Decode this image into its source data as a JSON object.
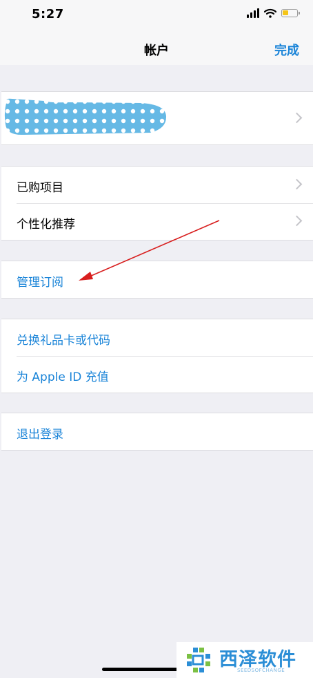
{
  "status_bar": {
    "time": "5:27"
  },
  "nav": {
    "title": "帐户",
    "done": "完成"
  },
  "sections": {
    "account": {
      "name_redacted": ""
    },
    "purchases": {
      "purchased": "已购项目",
      "personalized": "个性化推荐"
    },
    "subscriptions": {
      "manage": "管理订阅"
    },
    "redeem": {
      "redeem_gift": "兑换礼品卡或代码",
      "add_funds": "为 Apple ID 充值"
    },
    "signout": {
      "label": "退出登录"
    }
  },
  "watermark": {
    "title": "西泽软件",
    "subtitle": "SEEDSOFCHANGE"
  },
  "colors": {
    "accent": "#1a84d8",
    "arrow": "#d81e1e",
    "redaction": "#66b9e5",
    "battery": "#f5c518"
  }
}
